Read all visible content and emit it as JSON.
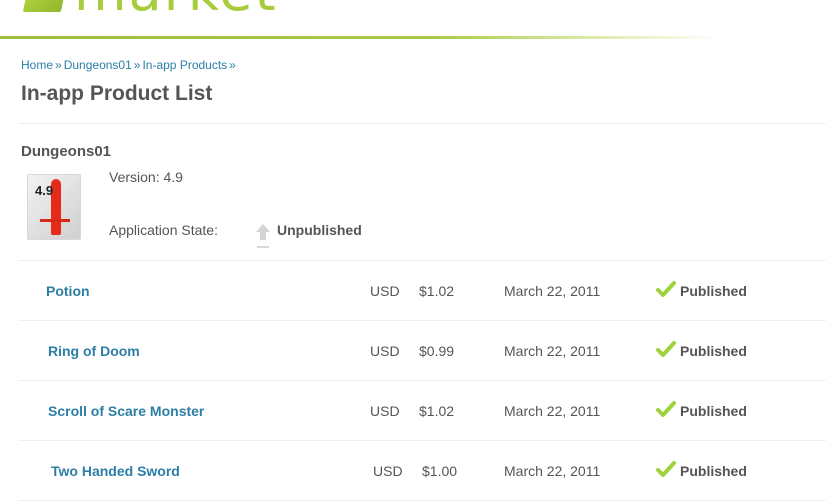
{
  "header": {
    "logo_text": "market"
  },
  "breadcrumb": {
    "items": [
      "Home",
      "Dungeons01",
      "In-app Products"
    ],
    "separator": "»"
  },
  "page_title": "In-app Product List",
  "app": {
    "name": "Dungeons01",
    "icon_label": "4.9",
    "version_label": "Version:",
    "version": "4.9",
    "state_label": "Application State:",
    "state": "Unpublished"
  },
  "products": [
    {
      "name": "Potion",
      "currency": "USD",
      "price": "$1.02",
      "date": "March 22, 2011",
      "status": "Published"
    },
    {
      "name": "Ring of Doom",
      "currency": "USD",
      "price": "$0.99",
      "date": "March 22, 2011",
      "status": "Published"
    },
    {
      "name": "Scroll of Scare Monster",
      "currency": "USD",
      "price": "$1.02",
      "date": "March 22, 2011",
      "status": "Published"
    },
    {
      "name": "Two Handed Sword",
      "currency": "USD",
      "price": "$1.00",
      "date": "March 22, 2011",
      "status": "Published"
    }
  ],
  "colors": {
    "brand_green": "#a8cd3c",
    "link_blue": "#2c7ea6",
    "check_green": "#9fd23a",
    "text_gray": "#555555"
  }
}
